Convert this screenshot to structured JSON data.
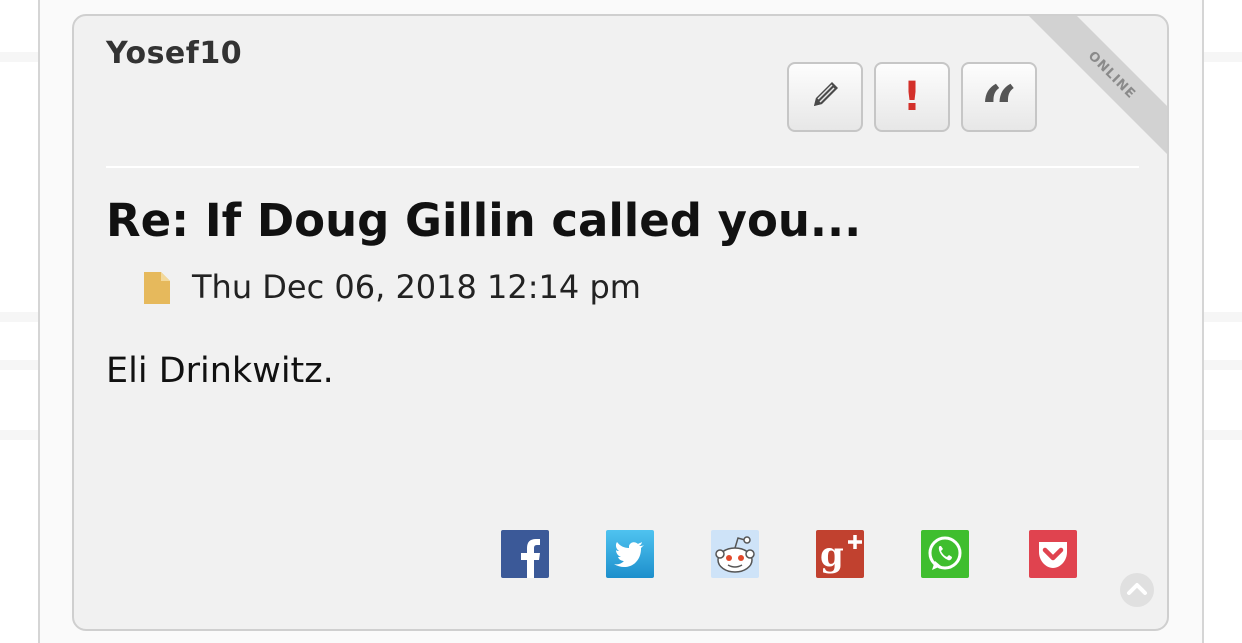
{
  "post": {
    "author": "Yosef10",
    "status_ribbon": "ONLINE",
    "title": "Re: If Doug Gillin called you...",
    "timestamp": "Thu Dec 06, 2018 12:14 pm",
    "body": "Eli Drinkwitz.",
    "actions": {
      "edit": {
        "icon": "pencil-icon"
      },
      "report": {
        "icon": "exclamation-icon",
        "label": "!"
      },
      "quote": {
        "icon": "quote-icon",
        "label": "“"
      }
    },
    "post_icon": "document-icon"
  },
  "share": [
    {
      "name": "facebook",
      "icon": "facebook-icon",
      "color": "#3b5998"
    },
    {
      "name": "twitter",
      "icon": "twitter-icon",
      "color": "#2b9fd8"
    },
    {
      "name": "reddit",
      "icon": "reddit-icon",
      "color": "#cee3f8"
    },
    {
      "name": "google-plus",
      "icon": "google-plus-icon",
      "color": "#c1412f"
    },
    {
      "name": "whatsapp",
      "icon": "whatsapp-icon",
      "color": "#3fbe2e"
    },
    {
      "name": "pocket",
      "icon": "pocket-icon",
      "color": "#e0434f"
    }
  ],
  "colors": {
    "panel_bg": "#f1f1f1",
    "panel_border": "#cfcfcf",
    "report_red": "#d3302a",
    "post_icon_color": "#e6b95c"
  }
}
